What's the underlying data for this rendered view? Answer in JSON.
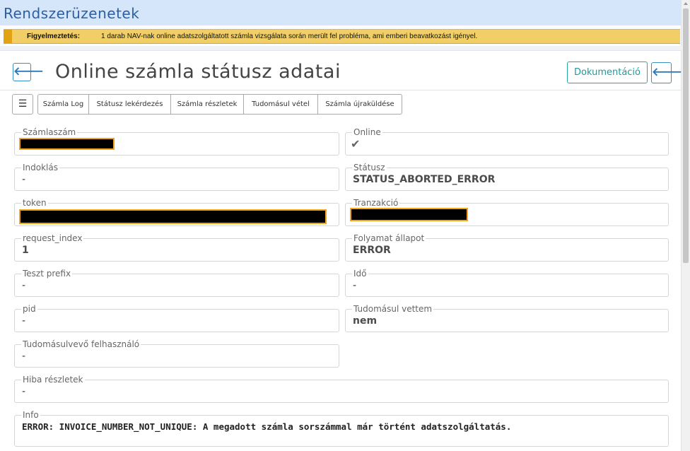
{
  "app": {
    "title": "Rendszerüzenetek"
  },
  "warning": {
    "label": "Figyelmeztetés:",
    "message": "1 darab NAV-nak online adatszolgáltatott számla vizsgálata során merült fel probléma, ami emberi beavatkozást igényel."
  },
  "page": {
    "title": "Online számla státusz adatai",
    "doc_button": "Dokumentáció",
    "back_icon": "arrow-left-icon",
    "back_icon_glyph": "🡐"
  },
  "toolbar": {
    "list_icon": "list-icon",
    "list_glyph": "☰",
    "buttons": [
      "Számla Log",
      "Státusz lekérdezés",
      "Számla részletek",
      "Tudomásul vétel",
      "Számla újraküldése"
    ]
  },
  "fields": {
    "szamlaszam": {
      "label": "Számlaszám",
      "value": ""
    },
    "online": {
      "label": "Online",
      "icon": "check-icon",
      "glyph": "✔"
    },
    "indoklas": {
      "label": "Indoklás",
      "value": "-"
    },
    "statusz": {
      "label": "Státusz",
      "value": "STATUS_ABORTED_ERROR"
    },
    "token": {
      "label": "token",
      "value": ""
    },
    "tranzakcio": {
      "label": "Tranzakció",
      "value": ""
    },
    "request_index": {
      "label": "request_index",
      "value": "1"
    },
    "folyamat": {
      "label": "Folyamat állapot",
      "value": "ERROR"
    },
    "teszt_prefix": {
      "label": "Teszt prefix",
      "value": "-"
    },
    "ido": {
      "label": "Idő",
      "value": "-"
    },
    "pid": {
      "label": "pid",
      "value": "-"
    },
    "tudomasul": {
      "label": "Tudomásul vettem",
      "value": "nem"
    },
    "felhasznalo": {
      "label": "Tudomásulvevő felhasználó",
      "value": "-"
    },
    "hiba": {
      "label": "Hiba részletek",
      "value": "-"
    },
    "info": {
      "label": "Info",
      "value": "ERROR: INVOICE_NUMBER_NOT_UNIQUE: A megadott számla sorszámmal már történt adatszolgáltatás."
    }
  },
  "colors": {
    "accent": "#2f78b8",
    "warning_bg": "#f1cf66",
    "doc_button": "#1f9a9a",
    "redaction_border": "#f2a51c"
  }
}
